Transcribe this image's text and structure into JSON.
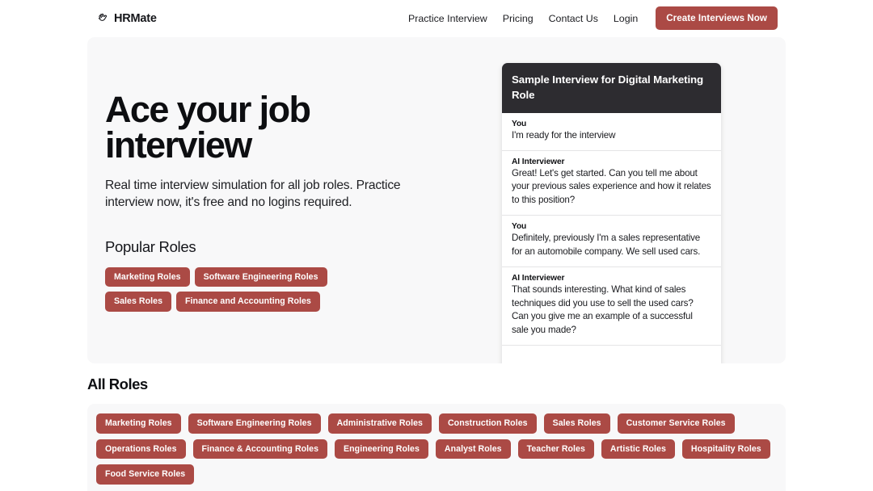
{
  "brand": {
    "name": "HRMate",
    "icon": "waving-hand-icon"
  },
  "nav": {
    "links": [
      {
        "label": "Practice Interview"
      },
      {
        "label": "Pricing"
      },
      {
        "label": "Contact Us"
      },
      {
        "label": "Login"
      }
    ],
    "cta_label": "Create Interviews Now"
  },
  "hero": {
    "title": "Ace your job interview",
    "subtitle": "Real time interview simulation for all job roles. Practice interview now, it's free and no logins required.",
    "popular_heading": "Popular Roles",
    "popular_roles": [
      "Marketing Roles",
      "Software Engineering Roles",
      "Sales Roles",
      "Finance and Accounting Roles"
    ]
  },
  "chat": {
    "header": "Sample Interview for Digital Marketing Role",
    "messages": [
      {
        "author": "You",
        "text": "I'm ready for the interview"
      },
      {
        "author": "AI Interviewer",
        "text": "Great! Let's get started. Can you tell me about your previous sales experience and how it relates to this position?"
      },
      {
        "author": "You",
        "text": "Definitely, previously I'm a sales representative for an automobile company. We sell used cars."
      },
      {
        "author": "AI Interviewer",
        "text": "That sounds interesting. What kind of sales techniques did you use to sell the used cars? Can you give me an example of a successful sale you made?"
      }
    ]
  },
  "all_roles": {
    "heading": "All Roles",
    "roles": [
      "Marketing Roles",
      "Software Engineering Roles",
      "Administrative Roles",
      "Construction Roles",
      "Sales Roles",
      "Customer Service Roles",
      "Operations Roles",
      "Finance & Accounting Roles",
      "Engineering Roles",
      "Analyst Roles",
      "Teacher Roles",
      "Artistic Roles",
      "Hospitality Roles",
      "Food Service Roles"
    ]
  },
  "colors": {
    "accent": "#ab4a45",
    "dark": "#2d2c30",
    "card_bg": "#f8f8f9",
    "text": "#15161a"
  }
}
